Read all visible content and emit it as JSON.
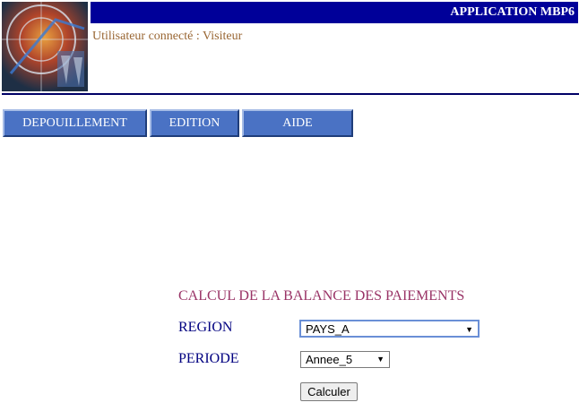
{
  "header": {
    "app_title": "APPLICATION MBP6",
    "user_status": "Utilisateur connecté : Visiteur"
  },
  "menu": {
    "items": [
      {
        "label": "DEPOUILLEMENT"
      },
      {
        "label": "EDITION"
      },
      {
        "label": "AIDE"
      }
    ]
  },
  "form": {
    "title": "CALCUL DE LA BALANCE DES PAIEMENTS",
    "region": {
      "label": "REGION",
      "selected": "PAYS_A"
    },
    "periode": {
      "label": "PERIODE",
      "selected": "Annee_5"
    },
    "submit_label": "Calculer"
  },
  "icons": {
    "logo": "globe-logo",
    "dropdown": "chevron-down-icon"
  },
  "colors": {
    "title_bar": "#000099",
    "menu_button": "#4a72c4",
    "user_text": "#996633",
    "form_title": "#993366",
    "form_label": "#000080"
  }
}
